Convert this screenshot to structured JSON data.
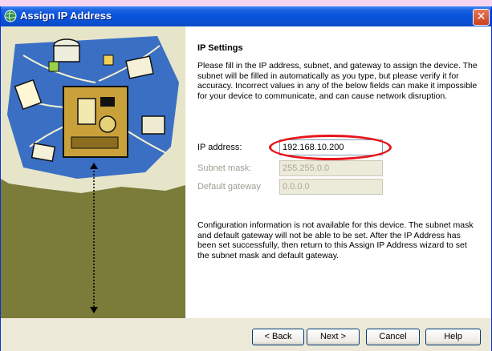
{
  "window": {
    "title": "Assign IP Address",
    "close_glyph": "✕"
  },
  "content": {
    "heading": "IP Settings",
    "description": "Please fill in the IP address, subnet, and gateway to assign the device. The subnet will be filled in automatically as you type, but please verify it for accuracy.  Incorrect values in any of the below fields can make it impossible for your device to communicate, and can cause network disruption.",
    "fields": [
      {
        "label": "IP address:",
        "value": "192.168.10.200",
        "enabled": true
      },
      {
        "label": "Subnet mask:",
        "value": "255.255.0.0",
        "enabled": false
      },
      {
        "label": "Default gateway",
        "value": "0.0.0.0",
        "enabled": false
      }
    ],
    "note": "Configuration information is not available for this device.  The subnet mask and default gateway will not be able to be set.  After the IP Address has been set successfully, then return to this Assign IP Address wizard to set the subnet mask and default gateway."
  },
  "buttons": {
    "back": "< Back",
    "next": "Next >",
    "cancel": "Cancel",
    "help": "Help"
  },
  "colors": {
    "highlight": "#e8141b",
    "side_panel": "#7b7b3a",
    "title_bar": "#0855dd"
  },
  "icons": {
    "title": "network-globe-icon"
  }
}
